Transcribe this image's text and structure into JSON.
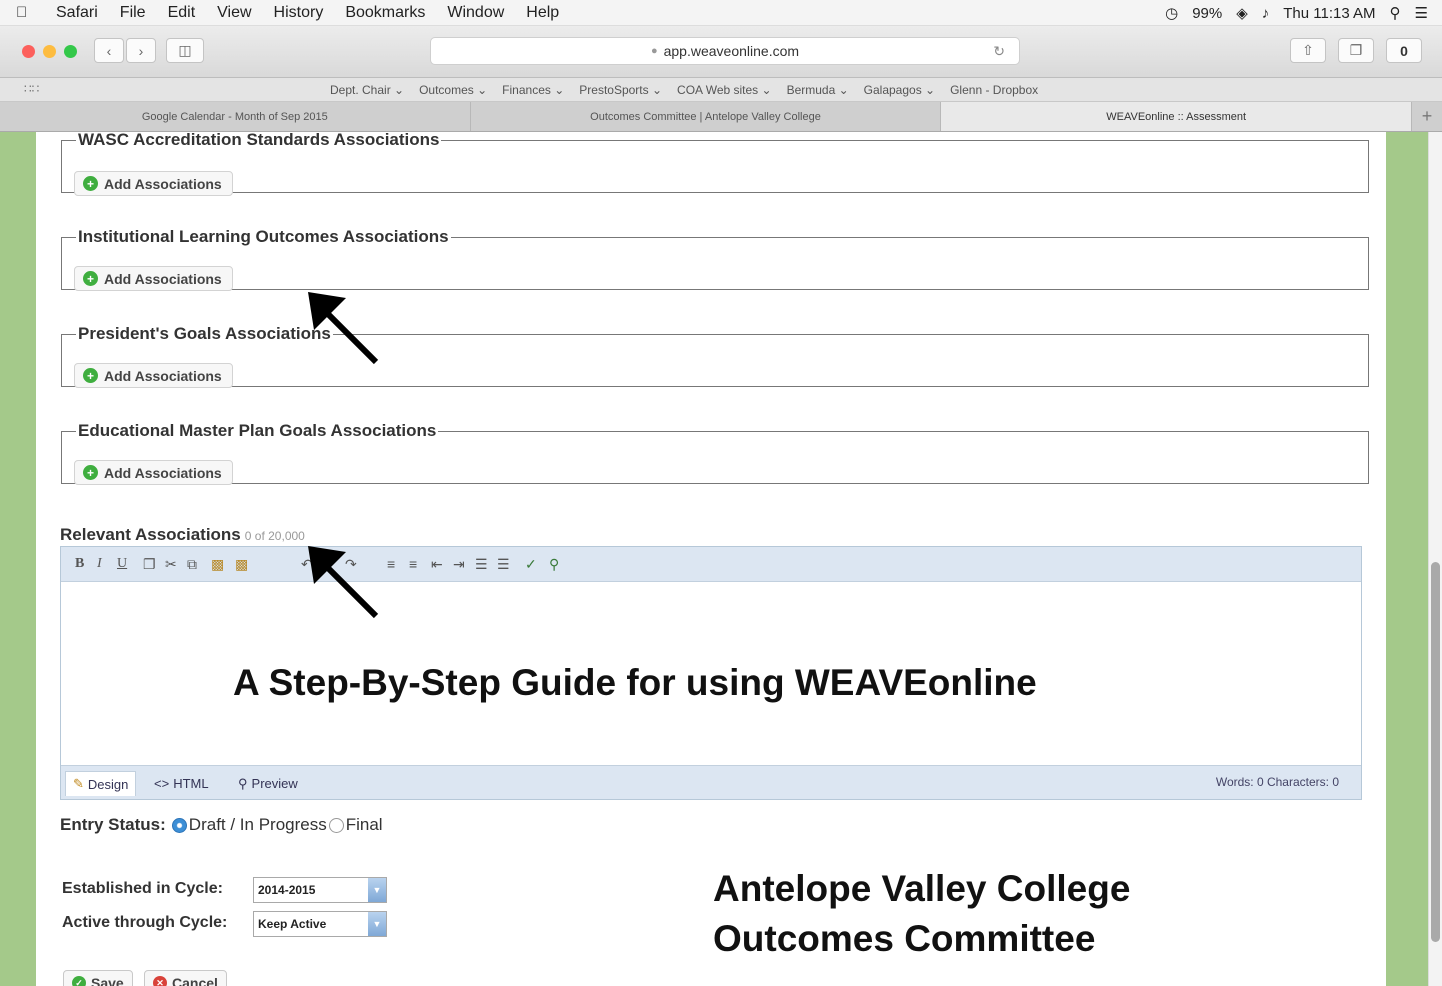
{
  "menubar": {
    "items": [
      "Safari",
      "File",
      "Edit",
      "View",
      "History",
      "Bookmarks",
      "Window",
      "Help"
    ],
    "battery": "99%",
    "clock": "Thu 11:13 AM"
  },
  "toolbar": {
    "url": "app.weaveonline.com"
  },
  "bookmarks": [
    "Dept. Chair ⌄",
    "Outcomes ⌄",
    "Finances ⌄",
    "PrestoSports ⌄",
    "COA Web sites ⌄",
    "Bermuda ⌄",
    "Galapagos ⌄",
    "Glenn - Dropbox"
  ],
  "tabs": [
    {
      "label": "Google Calendar - Month of Sep 2015",
      "active": false
    },
    {
      "label": "Outcomes Committee | Antelope Valley College",
      "active": false
    },
    {
      "label": "WEAVEonline :: Assessment",
      "active": true
    }
  ],
  "sections": [
    {
      "legend": "WASC Accreditation Standards Associations",
      "button": "Add Associations"
    },
    {
      "legend": "Institutional Learning Outcomes Associations",
      "button": "Add Associations"
    },
    {
      "legend": "President's Goals Associations",
      "button": "Add Associations"
    },
    {
      "legend": "Educational Master Plan Goals Associations",
      "button": "Add Associations"
    }
  ],
  "relevant": {
    "label": "Relevant Associations",
    "count": "0 of 20,000"
  },
  "editor": {
    "tabs": [
      "Design",
      "HTML",
      "Preview"
    ],
    "counts": "Words: 0  Characters: 0"
  },
  "overlay": {
    "guide_title": "A Step-By-Step Guide for using WEAVEonline",
    "org_line1": "Antelope Valley College",
    "org_line2": "Outcomes Committee"
  },
  "entry_status": {
    "label": "Entry Status:",
    "options": [
      "Draft / In Progress",
      "Final"
    ],
    "selected": "Draft / In Progress"
  },
  "cycles": {
    "established_label": "Established in Cycle:",
    "established_value": "2014-2015",
    "active_label": "Active through Cycle:",
    "active_value": "Keep Active"
  },
  "actions": {
    "save": "Save",
    "cancel": "Cancel"
  },
  "colors": {
    "side_green": "#a4c98a",
    "editor_blue": "#dce6f2",
    "add_green": "#3fae3f",
    "cancel_red": "#d9423a"
  }
}
